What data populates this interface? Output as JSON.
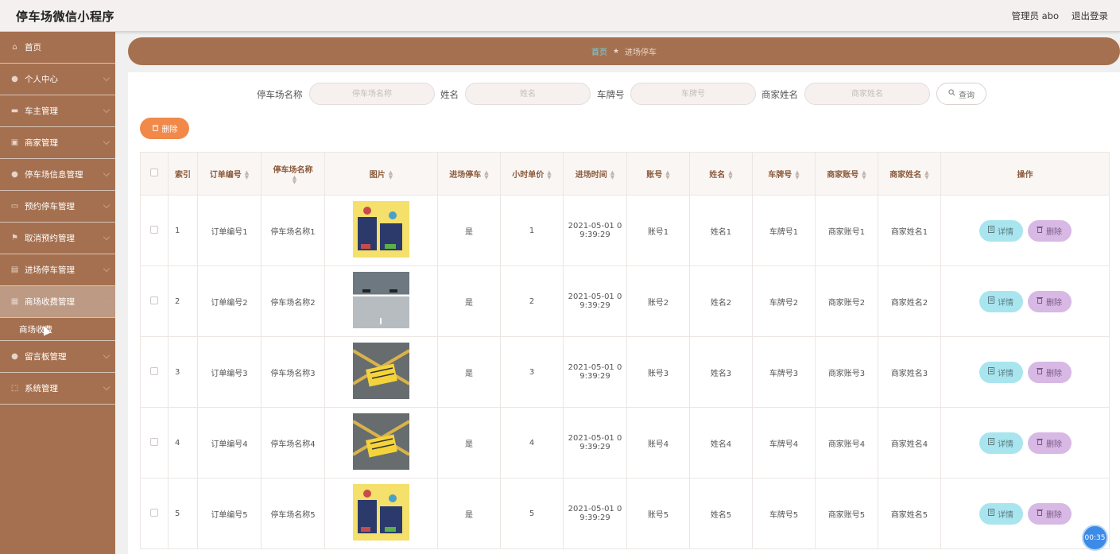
{
  "header": {
    "title": "停车场微信小程序",
    "admin": "管理员 abo",
    "logout": "退出登录"
  },
  "sidebar": {
    "items": [
      {
        "label": "首页",
        "icon": "home-icon"
      },
      {
        "label": "个人中心",
        "icon": "user-icon"
      },
      {
        "label": "车主管理",
        "icon": "car-icon"
      },
      {
        "label": "商家管理",
        "icon": "shop-icon"
      },
      {
        "label": "停车场信息管理",
        "icon": "user-icon"
      },
      {
        "label": "预约停车管理",
        "icon": "ticket-icon"
      },
      {
        "label": "取消预约管理",
        "icon": "flag-icon"
      },
      {
        "label": "进场停车管理",
        "icon": "gate-icon"
      },
      {
        "label": "商场收费管理",
        "icon": "grid-icon"
      },
      {
        "label": "留言板管理",
        "icon": "user-icon"
      },
      {
        "label": "系统管理",
        "icon": "square-icon"
      }
    ],
    "sub_item": "商场收费"
  },
  "breadcrumb": {
    "home": "首页",
    "current": "进场停车"
  },
  "search": {
    "lot_label": "停车场名称",
    "lot_placeholder": "停车场名称",
    "name_label": "姓名",
    "name_placeholder": "姓名",
    "plate_label": "车牌号",
    "plate_placeholder": "车牌号",
    "merchant_label": "商家姓名",
    "merchant_placeholder": "商家姓名",
    "query": "查询"
  },
  "toolbar": {
    "delete": "删除"
  },
  "table": {
    "headers": [
      "索引",
      "订单编号",
      "停车场名称",
      "图片",
      "进场停车",
      "小时单价",
      "进场时间",
      "账号",
      "姓名",
      "车牌号",
      "商家账号",
      "商家姓名",
      "操作"
    ],
    "rows": [
      {
        "idx": "1",
        "order": "订单编号1",
        "lot": "停车场名称1",
        "img": "yellow",
        "enter": "是",
        "price": "1",
        "time1": "2021-05-01 0",
        "time2": "9:39:29",
        "acct": "账号1",
        "name": "姓名1",
        "plate": "车牌号1",
        "macct": "商家账号1",
        "mname": "商家姓名1"
      },
      {
        "idx": "2",
        "order": "订单编号2",
        "lot": "停车场名称2",
        "img": "gray",
        "enter": "是",
        "price": "2",
        "time1": "2021-05-01 0",
        "time2": "9:39:29",
        "acct": "账号2",
        "name": "姓名2",
        "plate": "车牌号2",
        "macct": "商家账号2",
        "mname": "商家姓名2"
      },
      {
        "idx": "3",
        "order": "订单编号3",
        "lot": "停车场名称3",
        "img": "dark",
        "enter": "是",
        "price": "3",
        "time1": "2021-05-01 0",
        "time2": "9:39:29",
        "acct": "账号3",
        "name": "姓名3",
        "plate": "车牌号3",
        "macct": "商家账号3",
        "mname": "商家姓名3"
      },
      {
        "idx": "4",
        "order": "订单编号4",
        "lot": "停车场名称4",
        "img": "dark",
        "enter": "是",
        "price": "4",
        "time1": "2021-05-01 0",
        "time2": "9:39:29",
        "acct": "账号4",
        "name": "姓名4",
        "plate": "车牌号4",
        "macct": "商家账号4",
        "mname": "商家姓名4"
      },
      {
        "idx": "5",
        "order": "订单编号5",
        "lot": "停车场名称5",
        "img": "yellow",
        "enter": "是",
        "price": "5",
        "time1": "2021-05-01 0",
        "time2": "9:39:29",
        "acct": "账号5",
        "name": "姓名5",
        "plate": "车牌号5",
        "macct": "商家账号5",
        "mname": "商家姓名5"
      }
    ],
    "detail_label": "详情",
    "delete_label": "删除"
  },
  "timer": "00:35",
  "colors": {
    "sidebar": "#a5704f",
    "accent_orange": "#f0894a",
    "detail_btn": "#a8e5ef",
    "delete_btn": "#d8b8e4",
    "breadcrumb_home": "#76d4e5"
  }
}
